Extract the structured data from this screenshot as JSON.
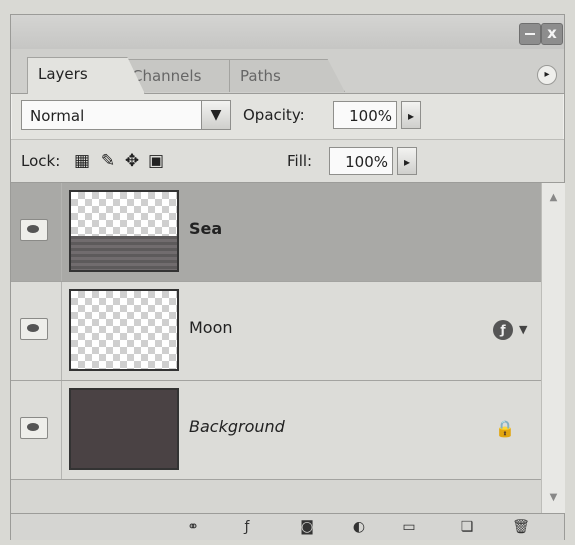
{
  "window": {
    "minimize_icon": "minimize-icon",
    "close_label": "x"
  },
  "tabs": [
    {
      "label": "Layers",
      "active": true
    },
    {
      "label": "Channels",
      "active": false
    },
    {
      "label": "Paths",
      "active": false
    }
  ],
  "menu_icon": "panel-menu-icon",
  "blend_mode": {
    "value": "Normal",
    "arrow": "▼"
  },
  "opacity": {
    "label": "Opacity:",
    "value": "100%",
    "stepper": "▸"
  },
  "lock": {
    "label": "Lock:",
    "icons": [
      "lock-transparent-icon",
      "lock-image-icon",
      "lock-position-icon",
      "lock-all-icon"
    ]
  },
  "fill": {
    "label": "Fill:",
    "value": "100%",
    "stepper": "▸"
  },
  "layers": [
    {
      "name": "Sea",
      "visible": true,
      "selected": true,
      "thumbnail": "sea"
    },
    {
      "name": "Moon",
      "visible": true,
      "selected": false,
      "thumbnail": "transparent",
      "has_effects": true
    },
    {
      "name": "Background",
      "visible": true,
      "selected": false,
      "thumbnail": "dark",
      "locked": true
    }
  ],
  "bottom_toolbar": [
    "link-layers-icon",
    "add-style-icon",
    "add-mask-icon",
    "new-adjustment-layer-icon",
    "new-group-icon",
    "new-layer-icon",
    "delete-layer-icon"
  ]
}
